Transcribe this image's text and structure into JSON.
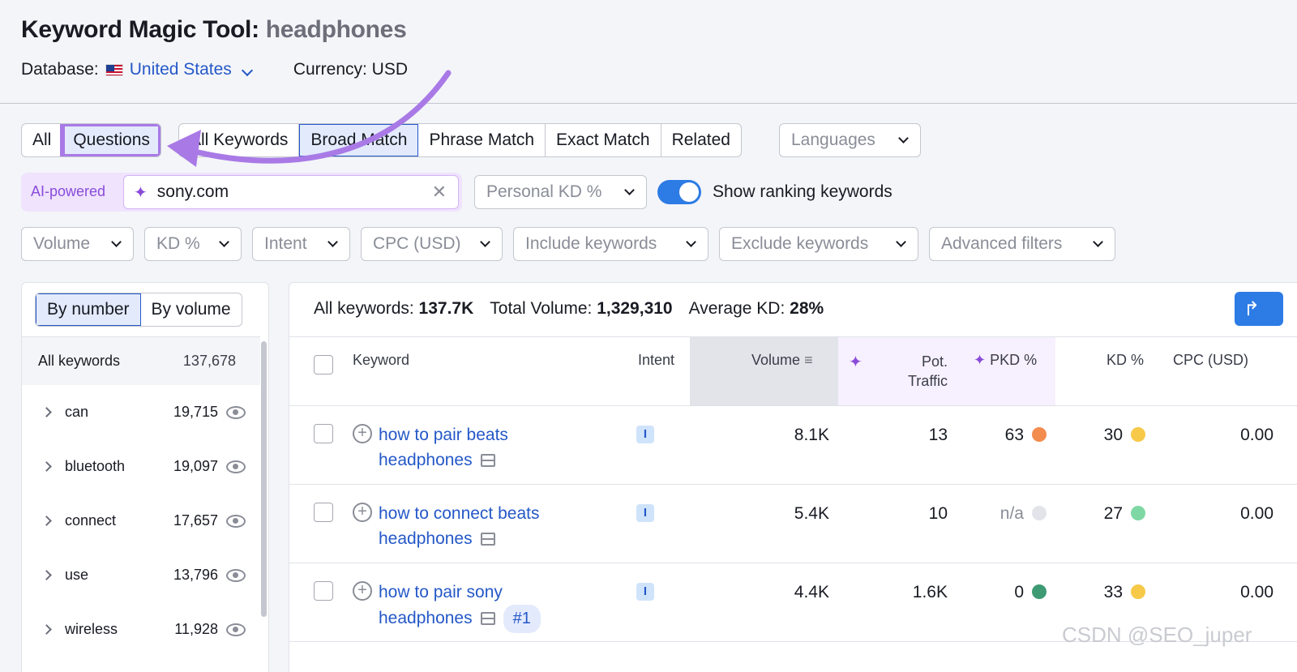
{
  "header": {
    "title": "Keyword Magic Tool:",
    "query": "headphones",
    "database_label": "Database:",
    "database_value": "United States",
    "currency": "Currency: USD"
  },
  "tabs": {
    "type": [
      {
        "label": "All"
      },
      {
        "label": "Questions"
      }
    ],
    "match": [
      {
        "label": "All Keywords"
      },
      {
        "label": "Broad Match"
      },
      {
        "label": "Phrase Match"
      },
      {
        "label": "Exact Match"
      },
      {
        "label": "Related"
      }
    ],
    "languages": "Languages"
  },
  "ai": {
    "label": "AI-powered",
    "domain": "sony.com",
    "personal_kd": "Personal KD %",
    "toggle_label": "Show ranking keywords"
  },
  "filters": [
    "Volume",
    "KD %",
    "Intent",
    "CPC (USD)",
    "Include keywords",
    "Exclude keywords",
    "Advanced filters"
  ],
  "groups": {
    "by_number": "By number",
    "by_volume": "By volume",
    "all_label": "All keywords",
    "all_count": "137,678",
    "items": [
      {
        "label": "can",
        "count": "19,715"
      },
      {
        "label": "bluetooth",
        "count": "19,097"
      },
      {
        "label": "connect",
        "count": "17,657"
      },
      {
        "label": "use",
        "count": "13,796"
      },
      {
        "label": "wireless",
        "count": "11,928"
      }
    ]
  },
  "summary": {
    "all_label": "All keywords:",
    "all_value": "137.7K",
    "volume_label": "Total Volume:",
    "volume_value": "1,329,310",
    "kd_label": "Average KD:",
    "kd_value": "28%"
  },
  "table": {
    "headers": {
      "keyword": "Keyword",
      "intent": "Intent",
      "volume": "Volume",
      "traffic": "Pot. Traffic",
      "pkd": "PKD %",
      "kd": "KD %",
      "cpc": "CPC (USD)"
    },
    "rows": [
      {
        "kw1": "how to pair beats",
        "kw2": "headphones",
        "intent": "I",
        "volume": "8.1K",
        "traffic": "13",
        "pkd": "63",
        "pkd_color": "#f28c4f",
        "kd": "30",
        "kd_color": "#f7c948",
        "cpc": "0.00",
        "badge": ""
      },
      {
        "kw1": "how to connect beats",
        "kw2": "headphones",
        "intent": "I",
        "volume": "5.4K",
        "traffic": "10",
        "pkd": "n/a",
        "pkd_color": "#e2e4ea",
        "kd": "27",
        "kd_color": "#7fd8a4",
        "cpc": "0.00",
        "badge": ""
      },
      {
        "kw1": "how to pair sony",
        "kw2": "headphones",
        "intent": "I",
        "volume": "4.4K",
        "traffic": "1.6K",
        "pkd": "0",
        "pkd_color": "#3d9a72",
        "kd": "33",
        "kd_color": "#f7c948",
        "cpc": "0.00",
        "badge": "#1"
      }
    ]
  },
  "watermark": "CSDN @SEO_juper"
}
